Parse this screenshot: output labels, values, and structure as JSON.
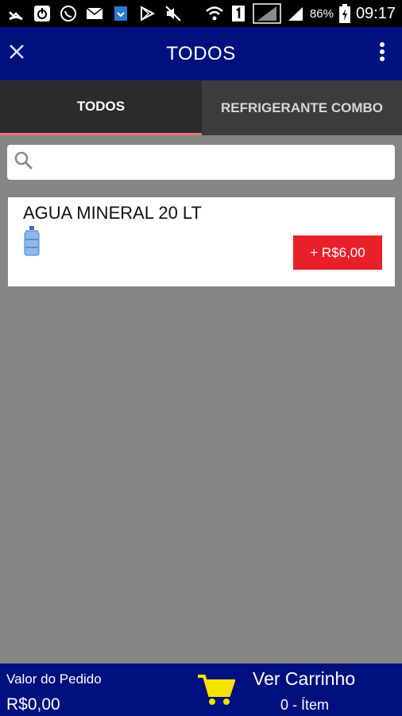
{
  "status_bar": {
    "battery_percent": "86%",
    "time": "09:17",
    "icons": [
      "missed-call-icon",
      "power-icon",
      "whatsapp-icon",
      "email-icon",
      "download-icon",
      "play-store-icon",
      "mute-icon",
      "wifi-icon",
      "sim-1-icon",
      "signal-icon",
      "signal-icon",
      "battery-icon"
    ]
  },
  "app_bar": {
    "title": "TODOS",
    "close_icon": "close-icon",
    "menu_icon": "more-vert-icon"
  },
  "tabs": [
    {
      "label": "TODOS",
      "selected": true
    },
    {
      "label": "REFRIGERANTE COMBO",
      "selected": false
    }
  ],
  "search": {
    "placeholder": "",
    "value": "",
    "icon": "search-icon"
  },
  "products": [
    {
      "name": "AGUA MINERAL 20 LT",
      "price_label": "+ R$6,00",
      "image": "water-jug-icon"
    }
  ],
  "bottom_bar": {
    "order_label": "Valor do Pedido",
    "order_total": "R$0,00",
    "cart_link": "Ver Carrinho",
    "cart_count": "0 - Ítem",
    "cart_icon": "shopping-cart-icon"
  },
  "colors": {
    "app_bar": "#00107f",
    "background": "#858585",
    "price_button": "#e8202a",
    "tab_indicator": "#e57373",
    "cart_icon": "#f4e300"
  }
}
